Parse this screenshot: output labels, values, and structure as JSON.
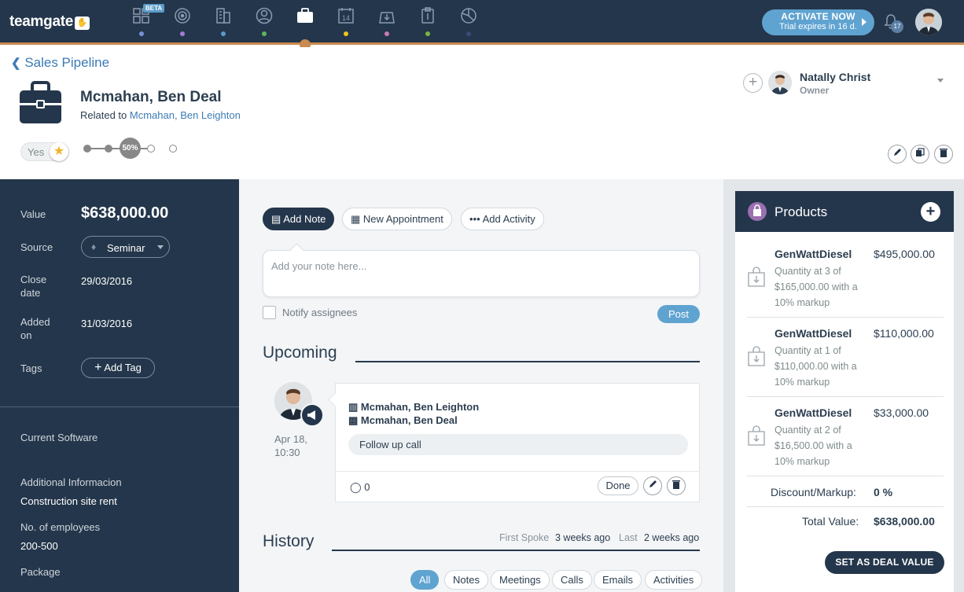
{
  "app": {
    "logo_text": "teamgate",
    "logo_mark": "✋"
  },
  "nav": {
    "items": [
      {
        "icon": "dashboard-icon",
        "dot": "#7b8fd6",
        "badge": "BETA"
      },
      {
        "icon": "target-icon",
        "dot": "#a07cd8"
      },
      {
        "icon": "buildings-icon",
        "dot": "#5b9bc8"
      },
      {
        "icon": "contacts-icon",
        "dot": "#5cb85c"
      },
      {
        "icon": "briefcase-icon",
        "dot": "#c98a4f"
      },
      {
        "icon": "calendar-icon",
        "dot": "#f0c419"
      },
      {
        "icon": "inbox-icon",
        "dot": "#c97ab5"
      },
      {
        "icon": "clipboard-icon",
        "dot": "#7cb342"
      },
      {
        "icon": "pie-chart-icon",
        "dot": "#3a4a7a"
      }
    ],
    "calendar_day": "14",
    "activate_label": "ACTIVATE NOW",
    "trial_text": "Trial expires in 16 d.",
    "notification_count": "17"
  },
  "header": {
    "back_label": "Sales Pipeline",
    "deal_title": "Mcmahan, Ben Deal",
    "related_prefix": "Related to",
    "related_link": "Mcmahan, Ben Leighton",
    "yes_label": "Yes",
    "stage_percent": "50%",
    "stage_progress": 0.5,
    "owner_name": "Natally Christ",
    "owner_role": "Owner"
  },
  "sidebar": {
    "value_label": "Value",
    "value": "$638,000.00",
    "source_label": "Source",
    "source_value": "Seminar",
    "close_label_1": "Close",
    "close_label_2": "date",
    "close_date": "29/03/2016",
    "added_label_1": "Added",
    "added_label_2": "on",
    "added_date": "31/03/2016",
    "tags_label": "Tags",
    "add_tag_label": "Add Tag",
    "custom_1_label": "Current Software",
    "custom_2_label": "Additional Informacion",
    "custom_2_value": "Construction site rent",
    "custom_3_label": "No. of employees",
    "custom_3_value": "200-500",
    "custom_4_label": "Package"
  },
  "main": {
    "tabs": {
      "add_note": "Add Note",
      "new_appointment": "New Appointment",
      "add_activity": "Add Activity"
    },
    "note_placeholder": "Add your note here...",
    "notify_label": "Notify assignees",
    "post_label": "Post",
    "upcoming_title": "Upcoming",
    "activity": {
      "date_1": "Apr 18,",
      "date_2": "10:30",
      "contact": "Mcmahan, Ben Leighton",
      "deal": "Mcmahan, Ben Deal",
      "task": "Follow up call",
      "comments": "0",
      "done_label": "Done"
    },
    "history_title": "History",
    "first_spoke_label": "First Spoke",
    "first_spoke_value": "3 weeks ago",
    "last_label": "Last",
    "last_value": "2 weeks ago",
    "filters": [
      "All",
      "Notes",
      "Meetings",
      "Calls",
      "Emails",
      "Activities"
    ]
  },
  "products": {
    "title": "Products",
    "items": [
      {
        "name": "GenWattDiesel",
        "price": "$495,000.00",
        "desc": "Quantity at 3 of $165,000.00 with a 10% markup"
      },
      {
        "name": "GenWattDiesel",
        "price": "$110,000.00",
        "desc": "Quantity at 1 of $110,000.00 with a 10% markup"
      },
      {
        "name": "GenWattDiesel",
        "price": "$33,000.00",
        "desc": "Quantity at 2 of $16,500.00 with a 10% markup"
      }
    ],
    "discount_label": "Discount/Markup:",
    "discount_value": "0 %",
    "total_label": "Total Value:",
    "total_value": "$638,000.00",
    "set_value_label": "SET AS DEAL VALUE"
  },
  "colors": {
    "navy": "#24364b",
    "accent_blue": "#5fa3d1",
    "orange": "#c98a4f"
  }
}
